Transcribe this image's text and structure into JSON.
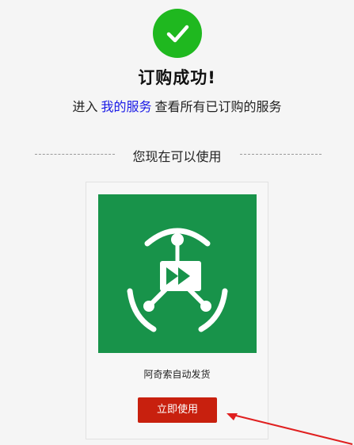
{
  "header": {
    "success_icon": "check-icon",
    "title": "订购成功!",
    "subtitle_prefix": "进入",
    "my_services_link": "我的服务",
    "subtitle_suffix": "查看所有已订购的服务"
  },
  "divider": {
    "label": "您现在可以使用"
  },
  "card": {
    "logo_icon": "qiyisuo-app-logo-icon",
    "app_name": "阿奇索自动发货",
    "use_button_label": "立即使用"
  },
  "colors": {
    "success_green": "#1fb81f",
    "logo_green": "#18934a",
    "button_red": "#c8200e",
    "link_blue": "#1a1ae6",
    "arrow_red": "#e02020"
  }
}
